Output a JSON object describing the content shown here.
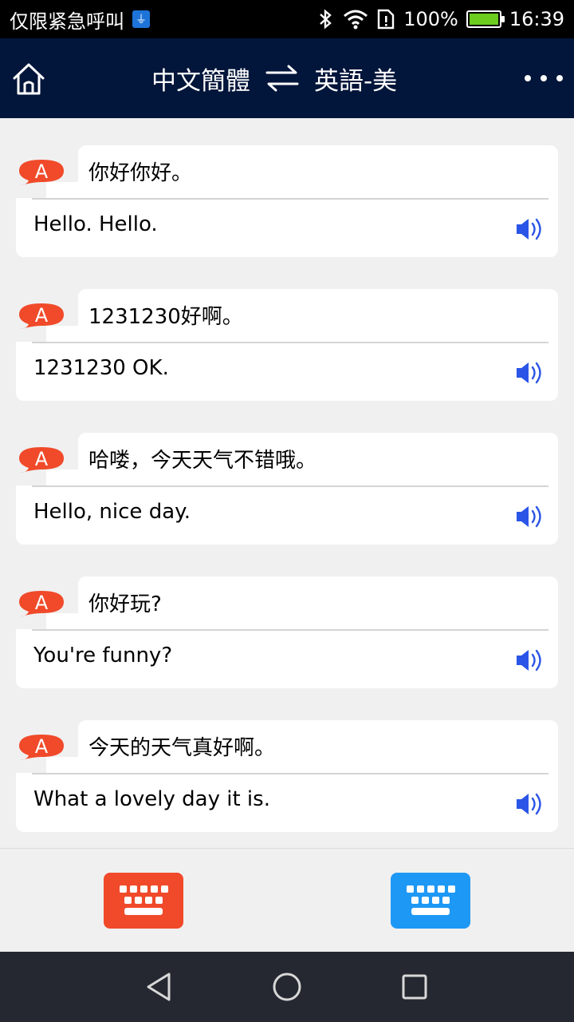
{
  "status_bar": {
    "carrier": "仅限紧急呼叫",
    "battery": "100%",
    "time": "16:39",
    "icons": [
      "usb-icon",
      "bluetooth-icon",
      "wifi-icon",
      "sim-alert-icon",
      "battery-icon"
    ],
    "battery_level": 1.0
  },
  "header": {
    "source_lang": "中文簡體",
    "target_lang": "英語-美",
    "icons": [
      "home-icon",
      "swap-arrows-icon",
      "more-dots-icon"
    ]
  },
  "avatar_label": "A",
  "messages": [
    {
      "source": "你好你好。",
      "translation": "Hello. Hello."
    },
    {
      "source": "1231230好啊。",
      "translation": "1231230 OK."
    },
    {
      "source": "哈喽，今天天气不错哦。",
      "translation": "Hello, nice day."
    },
    {
      "source": "你好玩?",
      "translation": "You're funny?"
    },
    {
      "source": "今天的天气真好啊。",
      "translation": "What a lovely day it is."
    }
  ],
  "toolbar": {
    "icons": [
      "keyboard-icon",
      "keyboard-icon"
    ]
  },
  "nav": {
    "icons": [
      "back-icon",
      "home-circle-icon",
      "recent-apps-icon"
    ]
  },
  "colors": {
    "header_bg": "#02153a",
    "avatar": "#f04a2a",
    "speaker": "#2a55e6",
    "kbd_left": "#f04a2a",
    "kbd_right": "#1e98f5",
    "nav_bg": "#252830"
  }
}
